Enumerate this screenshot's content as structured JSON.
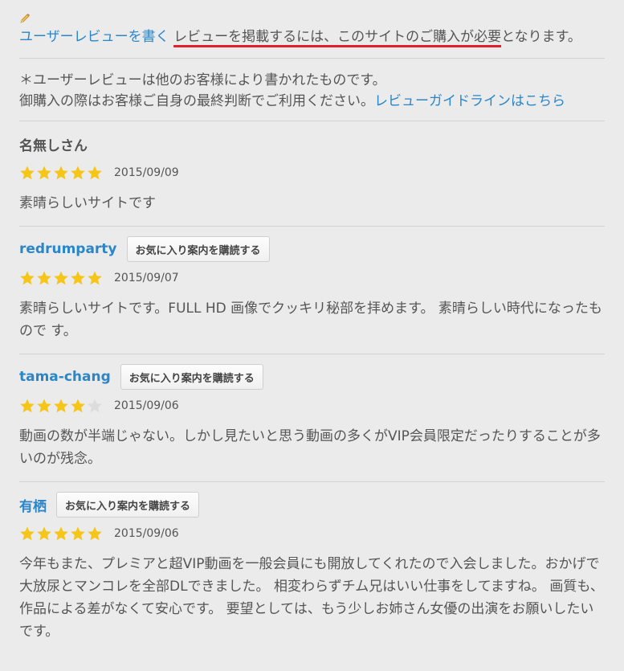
{
  "notice": {
    "write_review_link": "ユーザーレビューを書く",
    "requirement_text": "レビューを掲載するには、このサイトのご購入が必要",
    "requirement_tail": "となります。"
  },
  "disclaimer": {
    "line1": "＊ユーザーレビューは他のお客様により書かれたものです。",
    "line2": "御購入の際はお客様ご自身の最終判断でご利用ください。",
    "guideline_link": "レビューガイドラインはこちら"
  },
  "subscribe_label": "お気に入り案内を購読する",
  "colors": {
    "link": "#2a86c8",
    "star_filled": "#f5c518",
    "star_empty": "#dcdcdc",
    "underline": "#e0202e"
  },
  "reviews": [
    {
      "reviewer": "名無しさん",
      "date": "2015/09/09",
      "rating": 5,
      "body": "素晴らしいサイトです"
    },
    {
      "reviewer": "redrumparty",
      "date": "2015/09/07",
      "rating": 5,
      "body": "素晴らしいサイトです。FULL HD 画像でクッキリ秘部を拝めます。 素晴らしい時代になったもので す。"
    },
    {
      "reviewer": "tama-chang",
      "date": "2015/09/06",
      "rating": 4,
      "body": "動画の数が半端じゃない。しかし見たいと思う動画の多くがVIP会員限定だったりすることが多いのが残念。"
    },
    {
      "reviewer": "有栖",
      "date": "2015/09/06",
      "rating": 5,
      "body": "今年もまた、プレミアと超VIP動画を一般会員にも開放してくれたので入会しました。おかげで大放尿とマンコレを全部DLできました。 相変わらずチム兄はいい仕事をしてますね。 画質も、作品による差がなくて安心です。 要望としては、もう少しお姉さん女優の出演をお願いしたいです。"
    }
  ]
}
